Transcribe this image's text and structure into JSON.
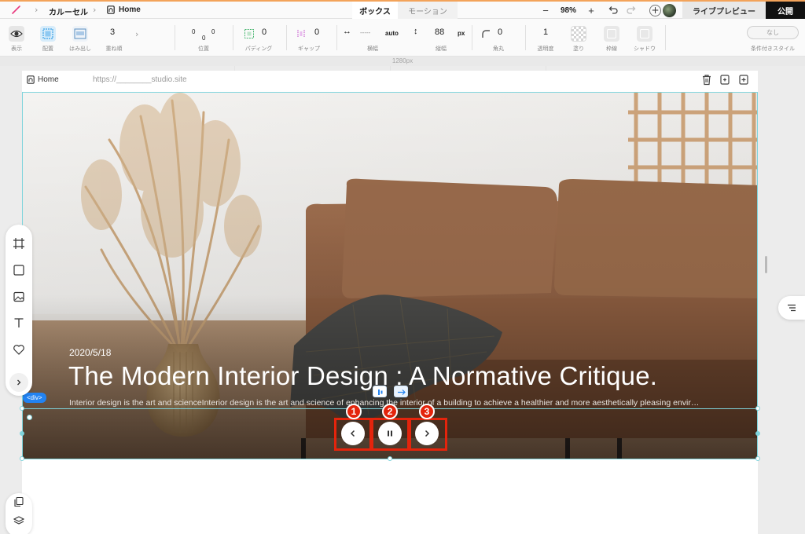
{
  "topbar": {
    "breadcrumb": [
      "カルーセル",
      "Home"
    ],
    "tabs": [
      {
        "label": "ボックス",
        "active": true
      },
      {
        "label": "モーション",
        "active": false
      }
    ],
    "zoom": {
      "minus": "−",
      "value": "98%",
      "plus": "+"
    },
    "live_preview": "ライブプレビュー",
    "publish": "公開"
  },
  "props": {
    "display": {
      "label": "表示"
    },
    "layout": {
      "label": "配置"
    },
    "overflow": {
      "label": "はみ出し"
    },
    "stack": {
      "value": "3",
      "label": "重ね順"
    },
    "position": {
      "label": "位置",
      "top": "0",
      "left": "0",
      "right": "0",
      "bottom": "0"
    },
    "padding": {
      "value": "0",
      "label": "パディング"
    },
    "gap": {
      "value": "0",
      "label": "ギャップ"
    },
    "width": {
      "value": "-----",
      "unit": "auto",
      "label": "横幅"
    },
    "height": {
      "value": "88",
      "unit": "px",
      "label": "縦幅"
    },
    "radius": {
      "value": "0",
      "label": "角丸"
    },
    "opacity": {
      "value": "1",
      "label": "透明度"
    },
    "fill": {
      "label": "塗り"
    },
    "border": {
      "label": "枠線"
    },
    "shadow": {
      "label": "シャドウ"
    },
    "conditional": {
      "value": "なし",
      "label": "条件付きスタイル"
    }
  },
  "ruler": {
    "width_label": "1280px"
  },
  "page": {
    "name": "Home",
    "url": "https://________studio.site"
  },
  "hero": {
    "date": "2020/5/18",
    "title": "The Modern Interior Design : A Normative Critique.",
    "description": "Interior design is the art and scienceInterior design is the art and science of enhancing the interior of a building to achieve a healthier and more aesthetically pleasing environment for the people using the space."
  },
  "selection": {
    "tag": "<div>"
  },
  "annotations": {
    "one": "1",
    "two": "2",
    "three": "3"
  },
  "colors": {
    "accent": "#7fd4dc",
    "highlight": "#e4240c",
    "tag": "#2283f2"
  }
}
